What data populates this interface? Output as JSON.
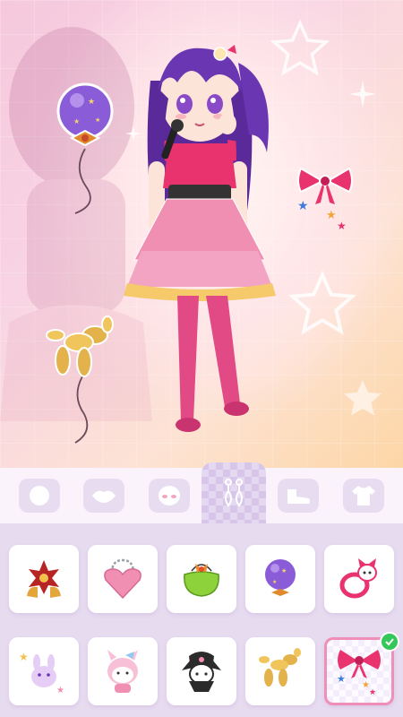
{
  "scene": {
    "character": "idol-girl",
    "accessories": [
      "purple-star-balloon",
      "pink-bow-stars",
      "gold-balloon-dog"
    ]
  },
  "tabs": [
    {
      "id": "face",
      "icon": "face-icon"
    },
    {
      "id": "lips",
      "icon": "lips-icon"
    },
    {
      "id": "eyes",
      "icon": "eyes-icon"
    },
    {
      "id": "accessories",
      "icon": "earrings-icon",
      "active": true
    },
    {
      "id": "shoes",
      "icon": "shoe-icon"
    },
    {
      "id": "tops",
      "icon": "tshirt-icon"
    }
  ],
  "items": [
    {
      "icon": "flower-bell-icon"
    },
    {
      "icon": "heart-purse-icon"
    },
    {
      "icon": "green-purse-icon"
    },
    {
      "icon": "star-balloon-icon"
    },
    {
      "icon": "bunny-ring-icon"
    },
    {
      "icon": "bunny-plush-icon"
    },
    {
      "icon": "melody-plush-icon"
    },
    {
      "icon": "kuromi-icon"
    },
    {
      "icon": "balloon-dog-icon"
    },
    {
      "icon": "bow-stars-icon",
      "selected": true
    }
  ],
  "colors": {
    "accent": "#ef8fb8",
    "tab_active": "#d7c5ea",
    "check": "#34c759"
  }
}
